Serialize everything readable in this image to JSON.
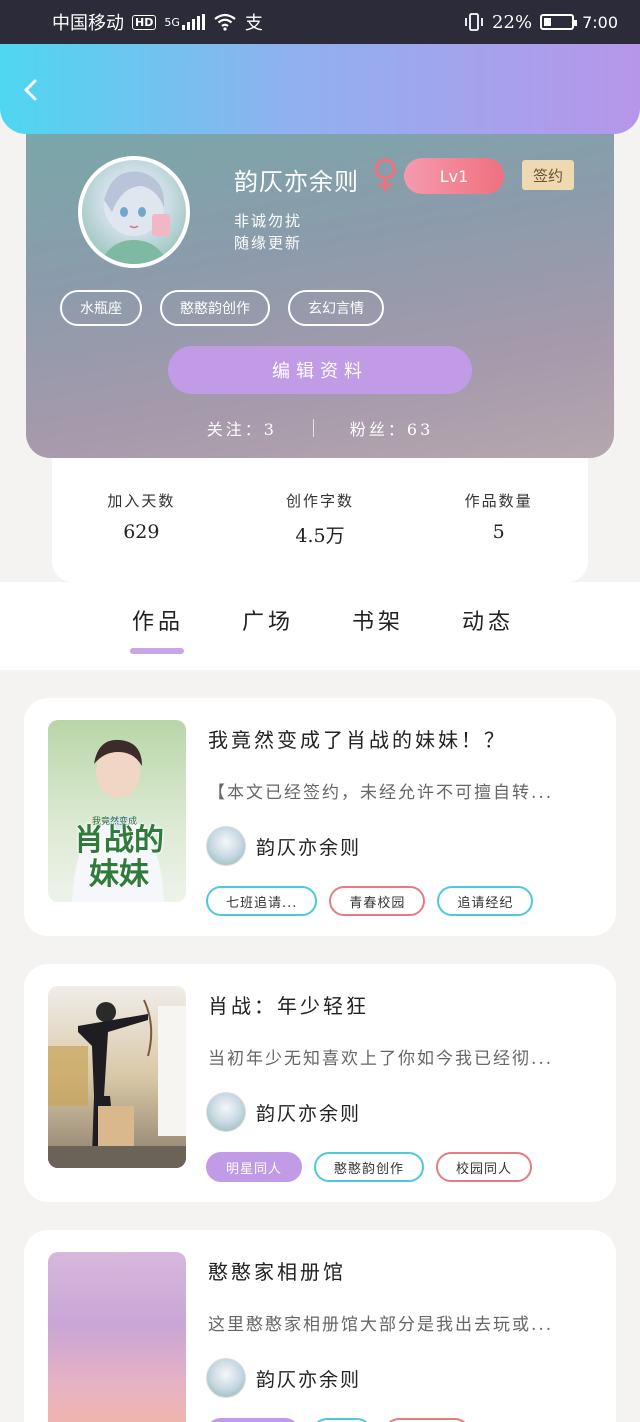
{
  "status_bar": {
    "carrier": "中国移动",
    "hd": "HD",
    "network": "5G",
    "battery": "22%",
    "time": "7:00"
  },
  "profile": {
    "name": "韵仄亦余则",
    "level": "Lv1",
    "signed_badge": "签约",
    "bio_line1": "非诚勿扰",
    "bio_line2": "随缘更新",
    "chips": [
      "水瓶座",
      "憨憨韵创作",
      "玄幻言情"
    ],
    "edit_button": "编辑资料",
    "following": "关注：3",
    "followers": "粉丝：63"
  },
  "stats": [
    {
      "label": "加入天数",
      "value": "629"
    },
    {
      "label": "创作字数",
      "value": "4.5万"
    },
    {
      "label": "作品数量",
      "value": "5"
    }
  ],
  "tabs": [
    "作品",
    "广场",
    "书架",
    "动态"
  ],
  "works": [
    {
      "title": "我竟然变成了肖战的妹妹！？",
      "desc": "【本文已经签约，未经允许不可擅自转...",
      "author": "韵仄亦余则",
      "cover_text": "肖战的妹妹",
      "cover_subtext": "我竟然变成",
      "tags": [
        {
          "text": "七班追请...",
          "style": "cyan"
        },
        {
          "text": "青春校园",
          "style": "red"
        },
        {
          "text": "追请经纪",
          "style": "cyan"
        }
      ]
    },
    {
      "title": "肖战：年少轻狂",
      "desc": "当初年少无知喜欢上了你如今我已经彻...",
      "author": "韵仄亦余则",
      "tags": [
        {
          "text": "明星同人",
          "style": "purple"
        },
        {
          "text": "憨憨韵创作",
          "style": "cyan"
        },
        {
          "text": "校园同人",
          "style": "red"
        }
      ]
    },
    {
      "title": "憨憨家相册馆",
      "desc": "这里憨憨家相册馆大部分是我出去玩或...",
      "author": "韵仄亦余则",
      "tags": []
    }
  ],
  "colors": {
    "accent_purple": "#c29be6",
    "header_cyan": "#4ed7f0",
    "header_violet": "#b796ea",
    "lvl_pink": "#f0707d"
  }
}
